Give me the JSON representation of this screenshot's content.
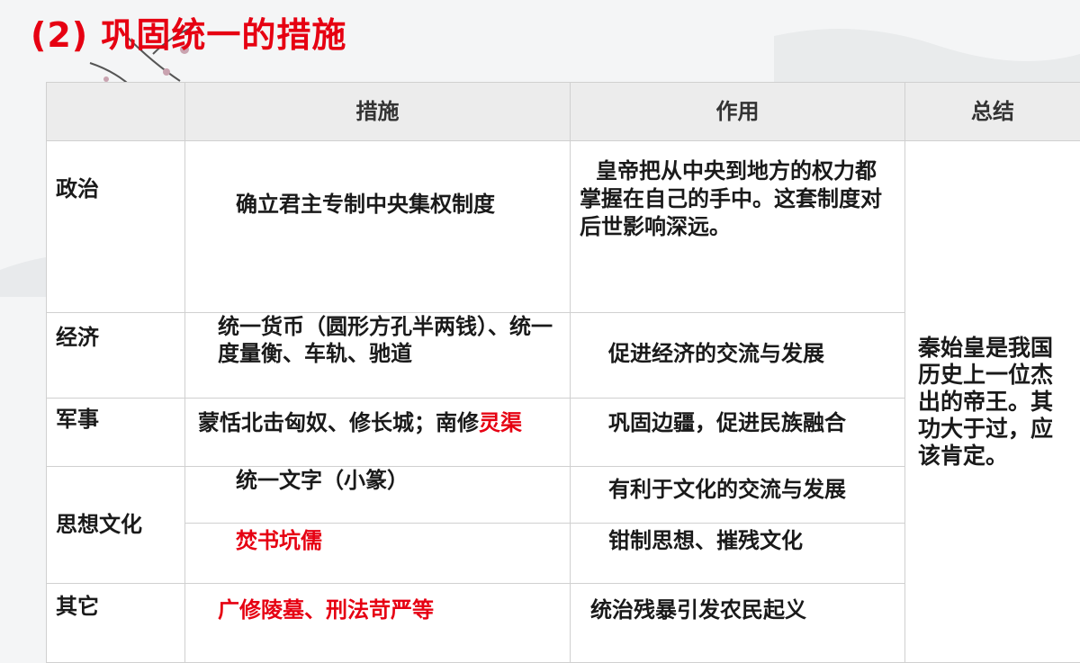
{
  "title": "(2) 巩固统一的措施",
  "table": {
    "headers": [
      "",
      "措施",
      "作用",
      "总结"
    ],
    "rows": [
      {
        "category": "政治",
        "measure": "确立君主专制中央集权制度",
        "effect": "皇帝把从中央到地方的权力都掌握在自己的手中。这套制度对后世影响深远。"
      },
      {
        "category": "经济",
        "measure": "统一货币（圆形方孔半两钱）、统一度量衡、车轨、驰道",
        "effect": "促进经济的交流与发展"
      },
      {
        "category": "军事",
        "measure_black": "蒙恬北击匈奴、修长城；南修",
        "measure_red": "灵渠",
        "effect": "巩固边疆，促进民族融合"
      },
      {
        "category": "思想文化",
        "measure": "统一文字（小篆）",
        "effect": "有利于文化的交流与发展"
      },
      {
        "measure": "焚书坑儒",
        "effect": "钳制思想、摧残文化"
      },
      {
        "category": "其它",
        "measure": "广修陵墓、刑法苛严等",
        "effect": "统治残暴引发农民起义"
      }
    ],
    "summary": "秦始皇是我国历史上一位杰出的帝王。其功大于过，应该肯定。"
  },
  "colors": {
    "title": "#e60012",
    "highlight": "#e60012",
    "header_bg": "#ececec"
  }
}
